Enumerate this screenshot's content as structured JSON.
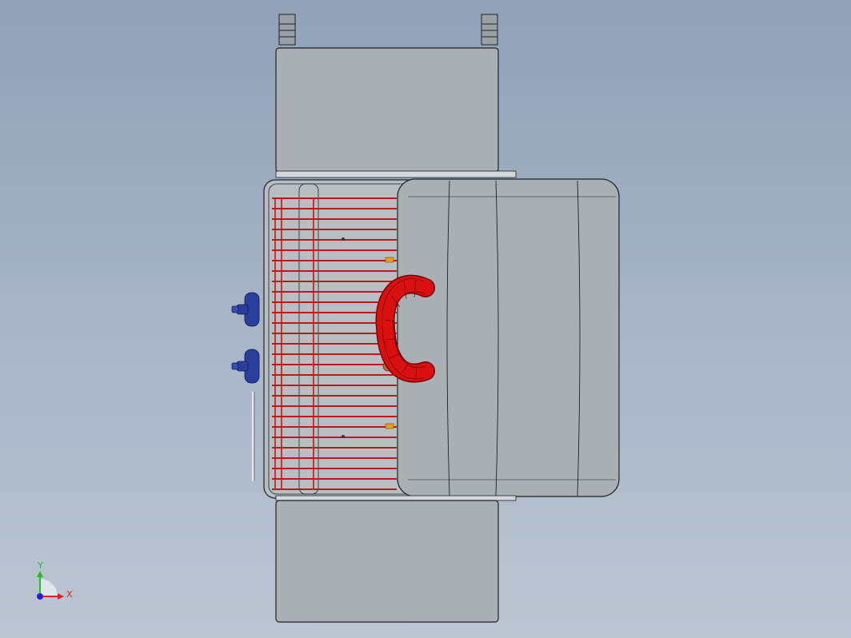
{
  "viewport": {
    "background_top": "#8fa2b7",
    "background_bottom": "#bcc5d2"
  },
  "model": {
    "body_color": "#a6aeb2",
    "edge_color": "#1e2226",
    "grille_color": "#c01818",
    "handle_color": "#d81010",
    "knob_color": "#2a3f9c",
    "pin_color": "#e8a020",
    "grille_bar_count": 29
  },
  "triad": {
    "x_label": "X",
    "y_label": "Y",
    "x_color": "#e02020",
    "y_color": "#20c020",
    "z_color": "#2020d0"
  }
}
